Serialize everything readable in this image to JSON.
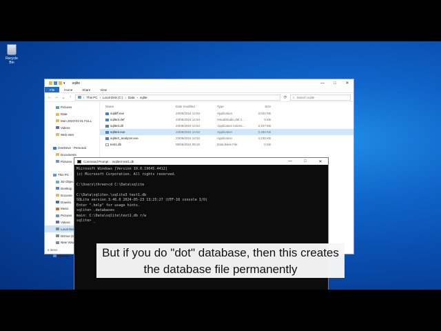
{
  "desktop": {
    "recycle_bin_label": "Recycle Bin"
  },
  "explorer": {
    "title": "sqlite",
    "ribbon_tabs": [
      "File",
      "Home",
      "Share",
      "View"
    ],
    "breadcrumb": [
      "This PC",
      "Local Disk (C:)",
      "Data",
      "sqlite"
    ],
    "search_placeholder": "Search sqlite",
    "nav_items": [
      {
        "label": "Pictures",
        "level": "l2"
      },
      {
        "label": "Data",
        "level": "l2"
      },
      {
        "label": "Mon 2023-01-01 FULL",
        "level": "l2"
      },
      {
        "label": "Videos",
        "level": "l2"
      },
      {
        "label": "Web Inter",
        "level": "l2"
      },
      {
        "label": "",
        "level": "l2"
      },
      {
        "label": "OneDrive - Personal",
        "level": "l1"
      },
      {
        "label": "Documents",
        "level": "l2"
      },
      {
        "label": "Pictures",
        "level": "l2"
      },
      {
        "label": "",
        "level": "l2"
      },
      {
        "label": "This PC",
        "level": "l1"
      },
      {
        "label": "3D Object",
        "level": "l2"
      },
      {
        "label": "Desktop",
        "level": "l2"
      },
      {
        "label": "Docume",
        "level": "l2"
      },
      {
        "label": "Downlo",
        "level": "l2"
      },
      {
        "label": "Music",
        "level": "l2"
      },
      {
        "label": "Pictures",
        "level": "l2"
      },
      {
        "label": "Videos",
        "level": "l2"
      },
      {
        "label": "Local Disk",
        "level": "l2"
      },
      {
        "label": "DDrive (D:",
        "level": "l2"
      },
      {
        "label": "New Volu",
        "level": "l2"
      },
      {
        "label": "",
        "level": "l2"
      },
      {
        "label": "Network",
        "level": "l1"
      }
    ],
    "columns": {
      "name": "Name",
      "date": "Date modified",
      "type": "Type",
      "size": "Size"
    },
    "files": [
      {
        "name": "sqldiff.exe",
        "date": "23/05/2024 14:53",
        "type": "Application",
        "size": "3,042 KB"
      },
      {
        "name": "sqlite3.def",
        "date": "23/05/2024 14:54",
        "type": "VisualStudio.def.1...",
        "size": "9 KB"
      },
      {
        "name": "sqlite3.dll",
        "date": "23/05/2024 14:54",
        "type": "Application extens...",
        "size": "3,107 KB"
      },
      {
        "name": "sqlite3.exe",
        "date": "23/05/2024 14:53",
        "type": "Application",
        "size": "3,485 KB"
      },
      {
        "name": "sqlite3_analyzer.exe",
        "date": "23/05/2024 14:53",
        "type": "Application",
        "size": "4,230 KB"
      },
      {
        "name": "test1.db",
        "date": "08/06/2024 09:15",
        "type": "Data Base File",
        "size": "0 KB"
      }
    ],
    "status": "6 items"
  },
  "cmd": {
    "title": "Command Prompt - .\\sqlite3  test1.db",
    "lines": "Microsoft Windows [Version 10.0.19045.4412]\n(c) Microsoft Corporation. All rights reserved.\n\nC:\\Users\\three>cd C:\\Data\\sqlite\n\nC:\\Data\\sqlite>.\\sqlite3 test1.db\nSQLite version 3.46.0 2024-05-23 13:25:27 (UTF-16 console I/O)\nEnter \".help\" for usage hints.\nsqlite> .databases\nmain: C:\\Data\\sqlite\\test1.db r/w\nsqlite> _"
  },
  "caption": {
    "line1": "But if you do \"dot\" database, then this creates",
    "line2": "the database file permanently"
  }
}
